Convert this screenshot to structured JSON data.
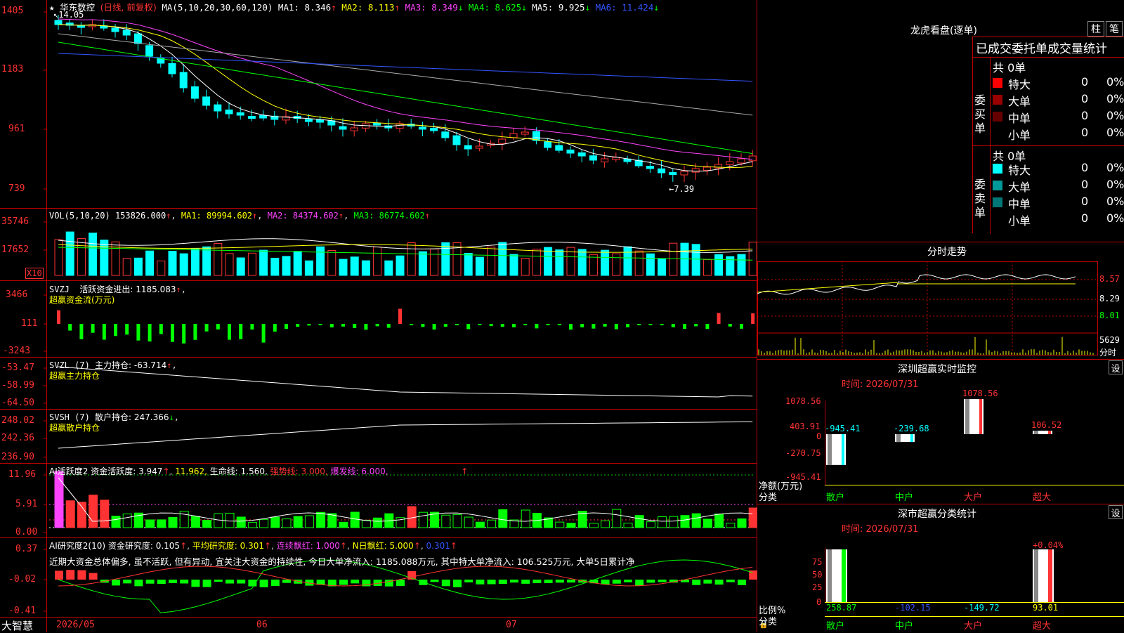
{
  "colors": {
    "up": "#ff3333",
    "down": "#00ffff",
    "ma1": "#ffffff",
    "ma2": "#ffff00",
    "ma3": "#ff44ff",
    "ma4": "#00ff00",
    "ma5": "#aaaaaa",
    "ma6": "#3355ff",
    "green": "#00ff00",
    "red": "#ff0000",
    "magenta": "#ff44ff",
    "frame": "#c00000"
  },
  "main": {
    "stock_name": "华东数控",
    "period": "(日线, 前复权)",
    "ma_label": "MA(5,10,20,30,60,120)",
    "ma1": "MA1: 8.346",
    "ma2": "MA2: 8.113",
    "ma3": "MA3: 8.349",
    "ma4": "MA4: 8.625",
    "ma5": "MA5: 9.925",
    "ma6": "MA6: 11.424",
    "high_label": "14.05",
    "low_label": "7.39",
    "y_ticks": [
      "1405",
      "1183",
      "961",
      "739"
    ]
  },
  "vol": {
    "label": "VOL(5,10,20)",
    "value": "153826.000",
    "ma1": "MA1: 89994.602",
    "ma2": "MA2: 84374.602",
    "ma3": "MA3: 86774.602",
    "y_ticks": [
      "35746",
      "17652"
    ],
    "unit": "X10"
  },
  "svzj": {
    "label": "SVZJ",
    "title": "活跃资金进出: 1185.083",
    "sub": "超赢资金流(万元)",
    "y_ticks": [
      "3466",
      "111",
      "-3243"
    ]
  },
  "svzl": {
    "label": "SVZL (7)",
    "title": "主力持仓: -63.714",
    "sub": "超赢主力持仓",
    "y_ticks": [
      "-53.47",
      "-58.99",
      "-64.50"
    ]
  },
  "svsh": {
    "label": "SVSH (7)",
    "title": "散户持仓: 247.366",
    "sub": "超赢散户持仓",
    "y_ticks": [
      "248.02",
      "242.36",
      "236.90"
    ]
  },
  "ai1": {
    "label": "AI活跃度2",
    "v1": "资金活跃度: 3.947",
    "v2": "11.962,",
    "v3": "生命线: 1.560,",
    "v4": "强势线: 3.000,",
    "v5": "爆发线: 6.000,",
    "y_ticks": [
      "11.96",
      "5.91",
      "0.00"
    ]
  },
  "ai2": {
    "label": "AI研究度2(10)",
    "v1": "资金研究度: 0.105",
    "v2": "平均研究度: 0.301",
    "v3": "连续飘红: 1.000",
    "v4": "N日飘红: 5.000",
    "v5": "0.301",
    "comment": "近期大资金总体偏多, 虽不活跃, 但有异动, 宜关注大资金的持续性, 今日大单净流入: 1185.088万元, 其中特大单净流入: 106.525万元, 大单5日累计净",
    "y_ticks": [
      "0.37",
      "-0.02",
      "-0.41"
    ]
  },
  "xaxis": {
    "app": "大智慧",
    "dates": [
      "2026/05",
      "06",
      "07"
    ]
  },
  "right": {
    "lhb_title": "龙虎看盘(逐单)",
    "btn1": "柱",
    "btn2": "笔",
    "stats_title": "已成交委托单成交量统计",
    "buy_label": "委买单",
    "sell_label": "委卖单",
    "buy_total": "共 0单",
    "sell_total": "共 0单",
    "buy_rows": [
      {
        "name": "特大",
        "count": "0",
        "pct": "0%",
        "color": "#ff0000"
      },
      {
        "name": "大单",
        "count": "0",
        "pct": "0%",
        "color": "#990000"
      },
      {
        "name": "中单",
        "count": "0",
        "pct": "0%",
        "color": "#660000"
      },
      {
        "name": "小单",
        "count": "0",
        "pct": "0%",
        "color": ""
      }
    ],
    "sell_rows": [
      {
        "name": "特大",
        "count": "0",
        "pct": "0%",
        "color": "#00ffff"
      },
      {
        "name": "大单",
        "count": "0",
        "pct": "0%",
        "color": "#009999"
      },
      {
        "name": "中单",
        "count": "0",
        "pct": "0%",
        "color": "#007777"
      },
      {
        "name": "小单",
        "count": "0",
        "pct": "0%",
        "color": ""
      }
    ],
    "fs_title": "分时走势",
    "fs_ticks": [
      "8.57",
      "8.29",
      "8.01"
    ],
    "fs_vol": "5629",
    "fs_vol_unit": "分时",
    "sz_title": "深圳超赢实时监控",
    "sz_set": "设",
    "sz_time": "时间: 2026/07/31",
    "sz_ticks": [
      "1078.56",
      "403.91",
      "0",
      "-270.75",
      "-945.41"
    ],
    "sz_axis_label1": "净额(万元)",
    "sz_axis_label2": "分类",
    "sz_values": [
      "-945.41",
      "-239.68",
      "1078.56",
      "106.52"
    ],
    "sz_cats": [
      "散户",
      "中户",
      "大户",
      "超大"
    ],
    "ss_title": "深市超赢分类统计",
    "ss_set": "设",
    "ss_time": "时间: 2026/07/31",
    "ss_ticks": [
      "75",
      "50",
      "25",
      "0"
    ],
    "ss_top": "+0.04%",
    "ss_axis_label1": "比例%",
    "ss_axis_label2": "分类",
    "ss_values": [
      "258.87",
      "-102.15",
      "-149.72",
      "93.01"
    ],
    "ss_cats": [
      "散户",
      "中户",
      "大户",
      "超大"
    ]
  },
  "chart_data": [
    {
      "type": "line",
      "title": "华东数控 (日线, 前复权)",
      "ylim": [
        7.39,
        14.05
      ],
      "series": [
        {
          "name": "MA1",
          "values": [
            8.346
          ]
        },
        {
          "name": "MA2",
          "values": [
            8.113
          ]
        },
        {
          "name": "MA3",
          "values": [
            8.349
          ]
        },
        {
          "name": "MA4",
          "values": [
            8.625
          ]
        },
        {
          "name": "MA5",
          "values": [
            9.925
          ]
        },
        {
          "name": "MA6",
          "values": [
            11.424
          ]
        }
      ]
    },
    {
      "type": "bar",
      "title": "VOL(5,10,20)",
      "series": [
        {
          "name": "VOL",
          "values": [
            153826.0
          ]
        }
      ]
    },
    {
      "type": "bar",
      "title": "深圳超赢实时监控",
      "categories": [
        "散户",
        "中户",
        "大户",
        "超大"
      ],
      "values": [
        -945.41,
        -239.68,
        1078.56,
        106.52
      ],
      "ylim": [
        -945.41,
        1078.56
      ]
    },
    {
      "type": "bar",
      "title": "深市超赢分类统计",
      "categories": [
        "散户",
        "中户",
        "大户",
        "超大"
      ],
      "values": [
        258.87,
        -102.15,
        -149.72,
        93.01
      ]
    }
  ]
}
